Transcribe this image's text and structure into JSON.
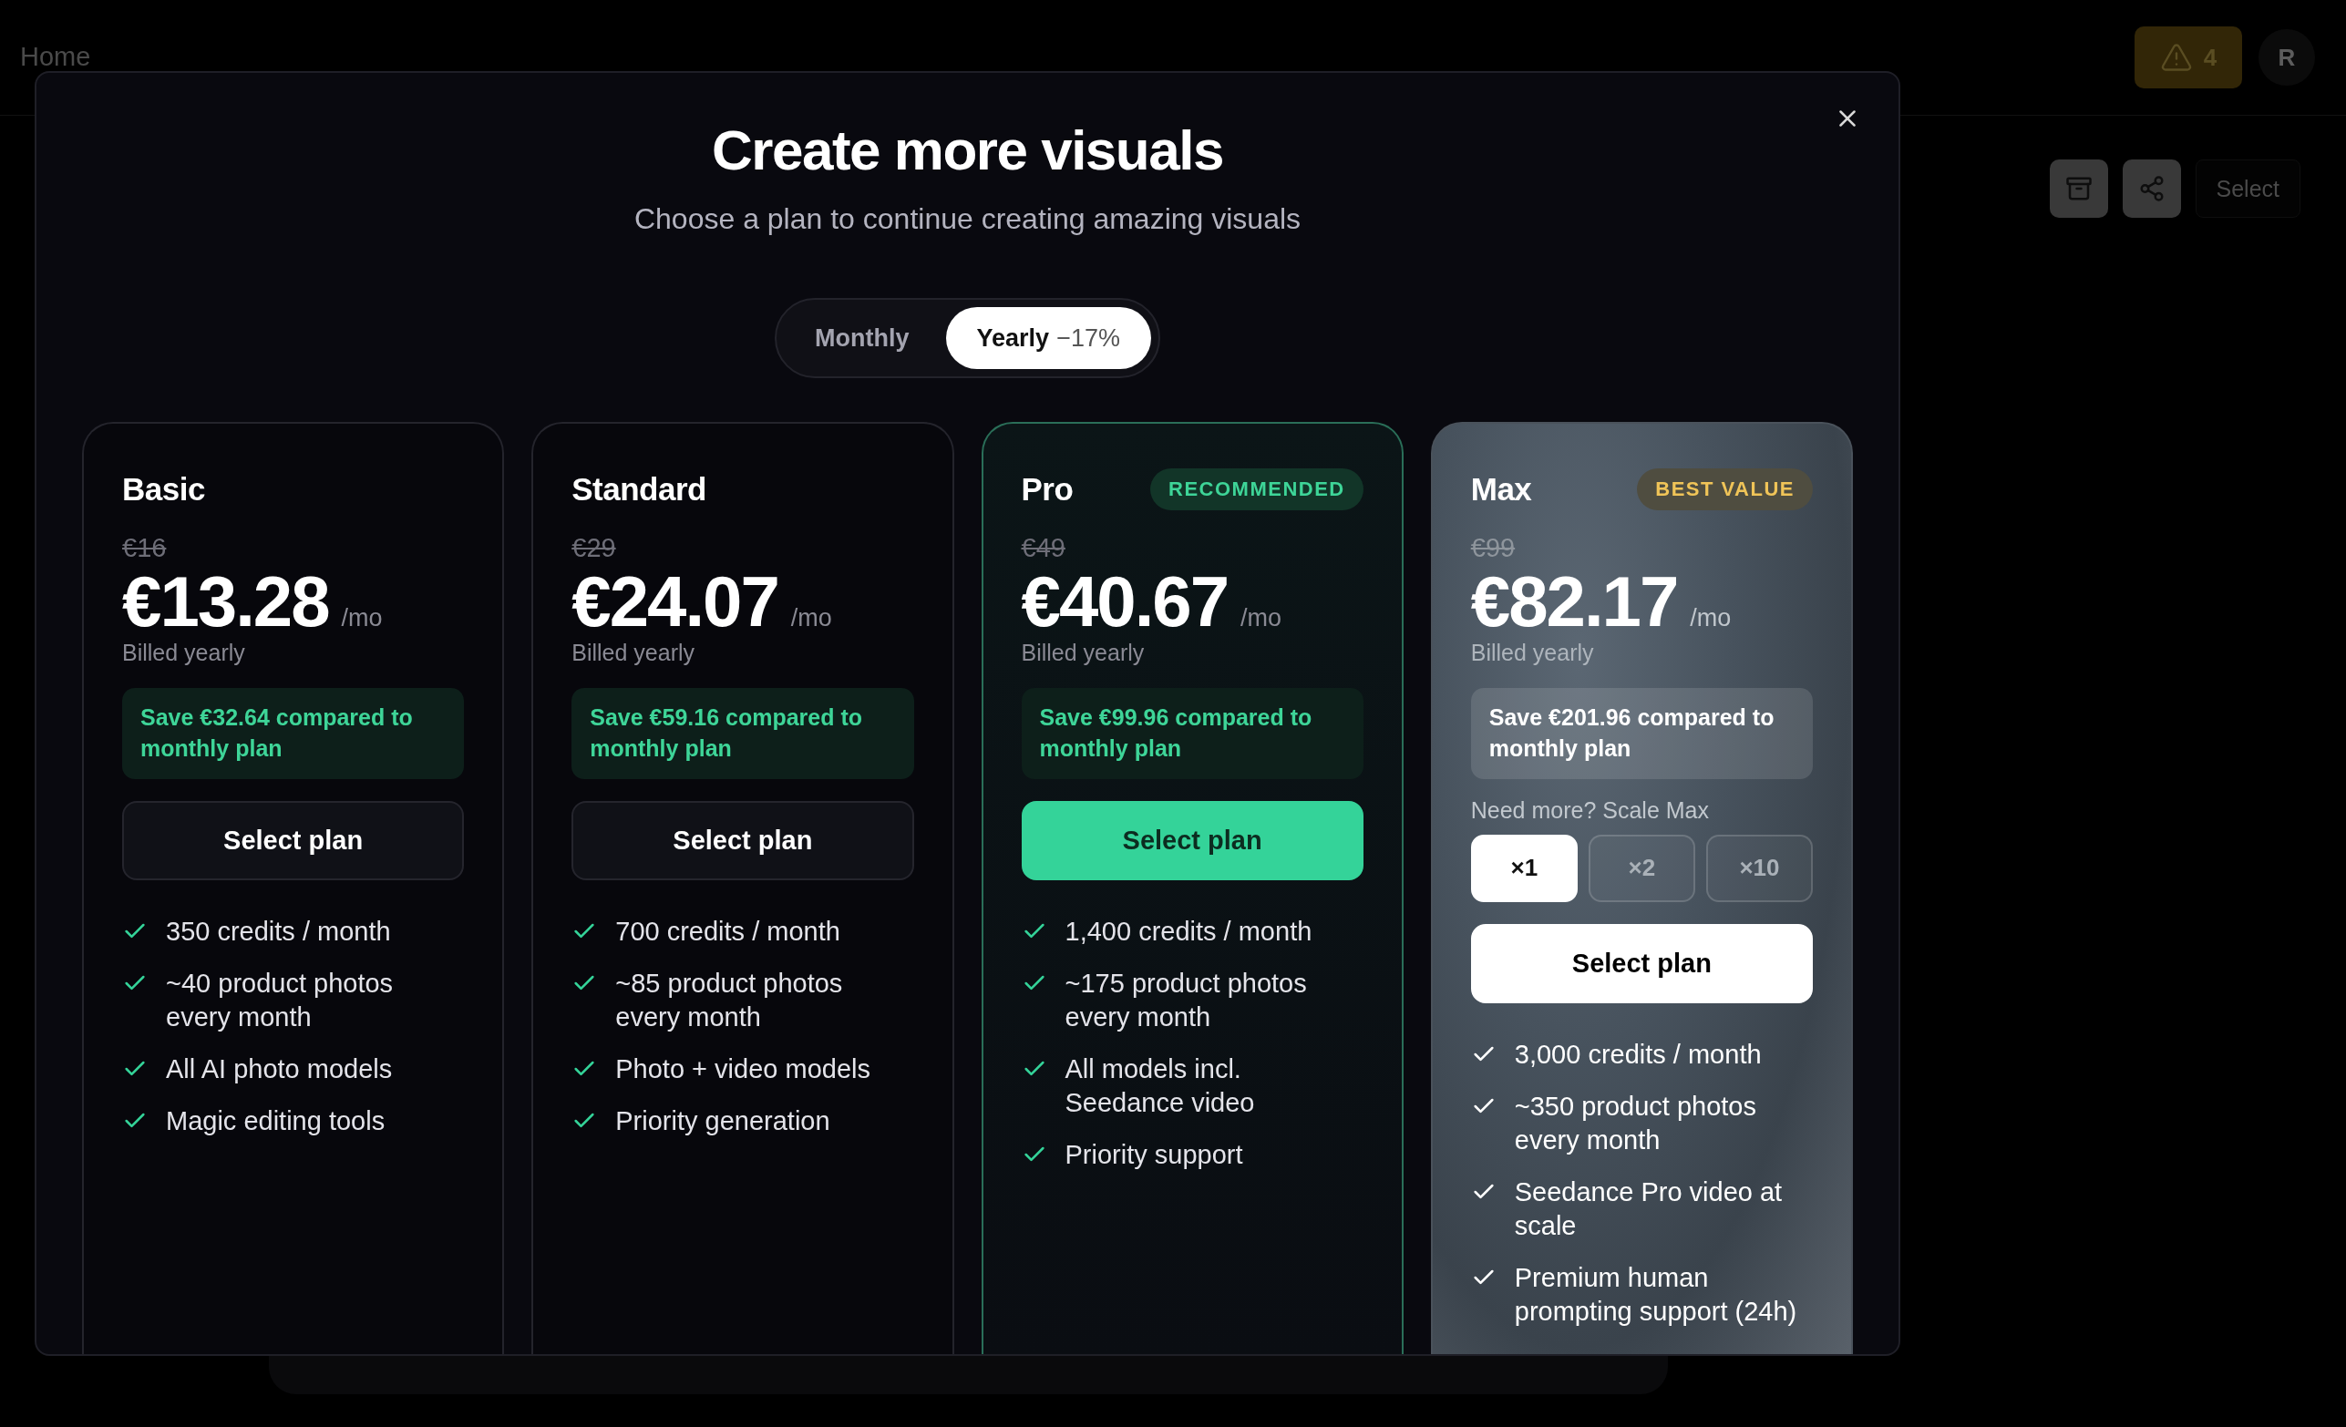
{
  "topbar": {
    "breadcrumb": "Home",
    "alert_count": "4",
    "avatar": "R"
  },
  "toolbar": {
    "select_label": "Select"
  },
  "modal": {
    "title": "Create more visuals",
    "subtitle": "Choose a plan to continue creating amazing visuals",
    "billing": [
      {
        "label": "Monthly",
        "selected": false
      },
      {
        "label": "Yearly",
        "discount": "−17%",
        "selected": true
      }
    ],
    "plans": [
      {
        "kind": "plain",
        "name": "Basic",
        "original_price": "€16",
        "price": "€13.28",
        "period": "/mo",
        "billing_note": "Billed yearly",
        "savings": "Save €32.64 compared to monthly plan",
        "cta": "Select plan",
        "features": [
          "350 credits / month",
          "~40 product photos every month",
          "All AI photo models",
          "Magic editing tools"
        ]
      },
      {
        "kind": "plain",
        "name": "Standard",
        "original_price": "€29",
        "price": "€24.07",
        "period": "/mo",
        "billing_note": "Billed yearly",
        "savings": "Save €59.16 compared to monthly plan",
        "cta": "Select plan",
        "features": [
          "700 credits / month",
          "~85 product photos every month",
          "Photo + video models",
          "Priority generation"
        ]
      },
      {
        "kind": "recommended",
        "name": "Pro",
        "badge": "RECOMMENDED",
        "original_price": "€49",
        "price": "€40.67",
        "period": "/mo",
        "billing_note": "Billed yearly",
        "savings": "Save €99.96 compared to monthly plan",
        "cta": "Select plan",
        "features": [
          "1,400 credits / month",
          "~175 product photos every month",
          "All models incl. Seedance video",
          "Priority support"
        ]
      },
      {
        "kind": "premium",
        "name": "Max",
        "badge": "BEST VALUE",
        "original_price": "€99",
        "price": "€82.17",
        "period": "/mo",
        "billing_note": "Billed yearly",
        "savings": "Save €201.96 compared to monthly plan",
        "scale": {
          "label": "Need more? Scale Max",
          "options": [
            {
              "label": "×1",
              "selected": true
            },
            {
              "label": "×2",
              "selected": false
            },
            {
              "label": "×10",
              "selected": false
            }
          ]
        },
        "cta": "Select plan",
        "features": [
          "3,000 credits / month",
          "~350 product photos every month",
          "Seedance Pro video at scale",
          "Premium human prompting support (24h)"
        ]
      }
    ]
  }
}
